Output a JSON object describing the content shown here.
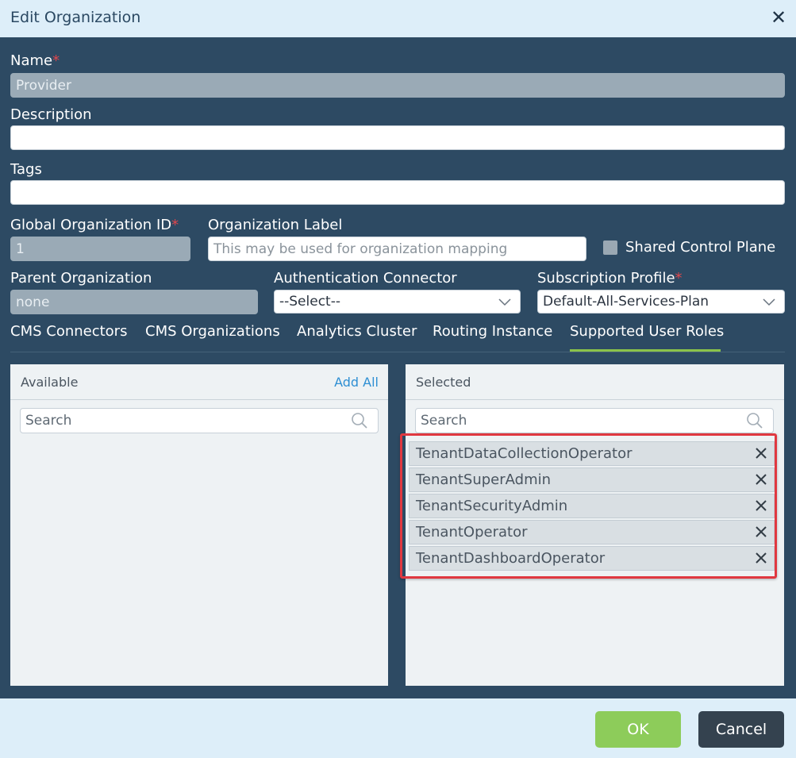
{
  "dialog": {
    "title": "Edit Organization"
  },
  "form": {
    "name": {
      "label": "Name",
      "required_mark": "*",
      "value": "Provider"
    },
    "description": {
      "label": "Description",
      "value": ""
    },
    "tags": {
      "label": "Tags",
      "value": ""
    },
    "global_org_id": {
      "label": "Global Organization ID",
      "required_mark": "*",
      "value": "1"
    },
    "org_label": {
      "label": "Organization Label",
      "placeholder": "This may be used for organization mapping",
      "value": ""
    },
    "shared_control_plane": {
      "label": "Shared Control Plane",
      "checked": false
    },
    "parent_org": {
      "label": "Parent Organization",
      "value": "none"
    },
    "auth_connector": {
      "label": "Authentication Connector",
      "selected": "--Select--"
    },
    "subscription_profile": {
      "label": "Subscription Profile",
      "required_mark": "*",
      "selected": "Default-All-Services-Plan"
    }
  },
  "tabs": [
    {
      "label": "CMS Connectors",
      "active": false
    },
    {
      "label": "CMS Organizations",
      "active": false
    },
    {
      "label": "Analytics Cluster",
      "active": false
    },
    {
      "label": "Routing Instance",
      "active": false
    },
    {
      "label": "Supported User Roles",
      "active": true
    }
  ],
  "available_panel": {
    "title": "Available",
    "add_all": "Add All",
    "search_placeholder": "Search"
  },
  "selected_panel": {
    "title": "Selected",
    "search_placeholder": "Search",
    "roles": [
      "TenantDataCollectionOperator",
      "TenantSuperAdmin",
      "TenantSecurityAdmin",
      "TenantOperator",
      "TenantDashboardOperator"
    ]
  },
  "footer": {
    "ok_label": "OK",
    "cancel_label": "Cancel"
  },
  "colors": {
    "body_bg": "#2d4a63",
    "header_bg": "#ddeef9",
    "accent_green": "#8dcc5a",
    "tab_underline": "#8bc34a",
    "required": "#e0464c",
    "highlight": "#e03840",
    "link_blue": "#2e8fd3"
  }
}
